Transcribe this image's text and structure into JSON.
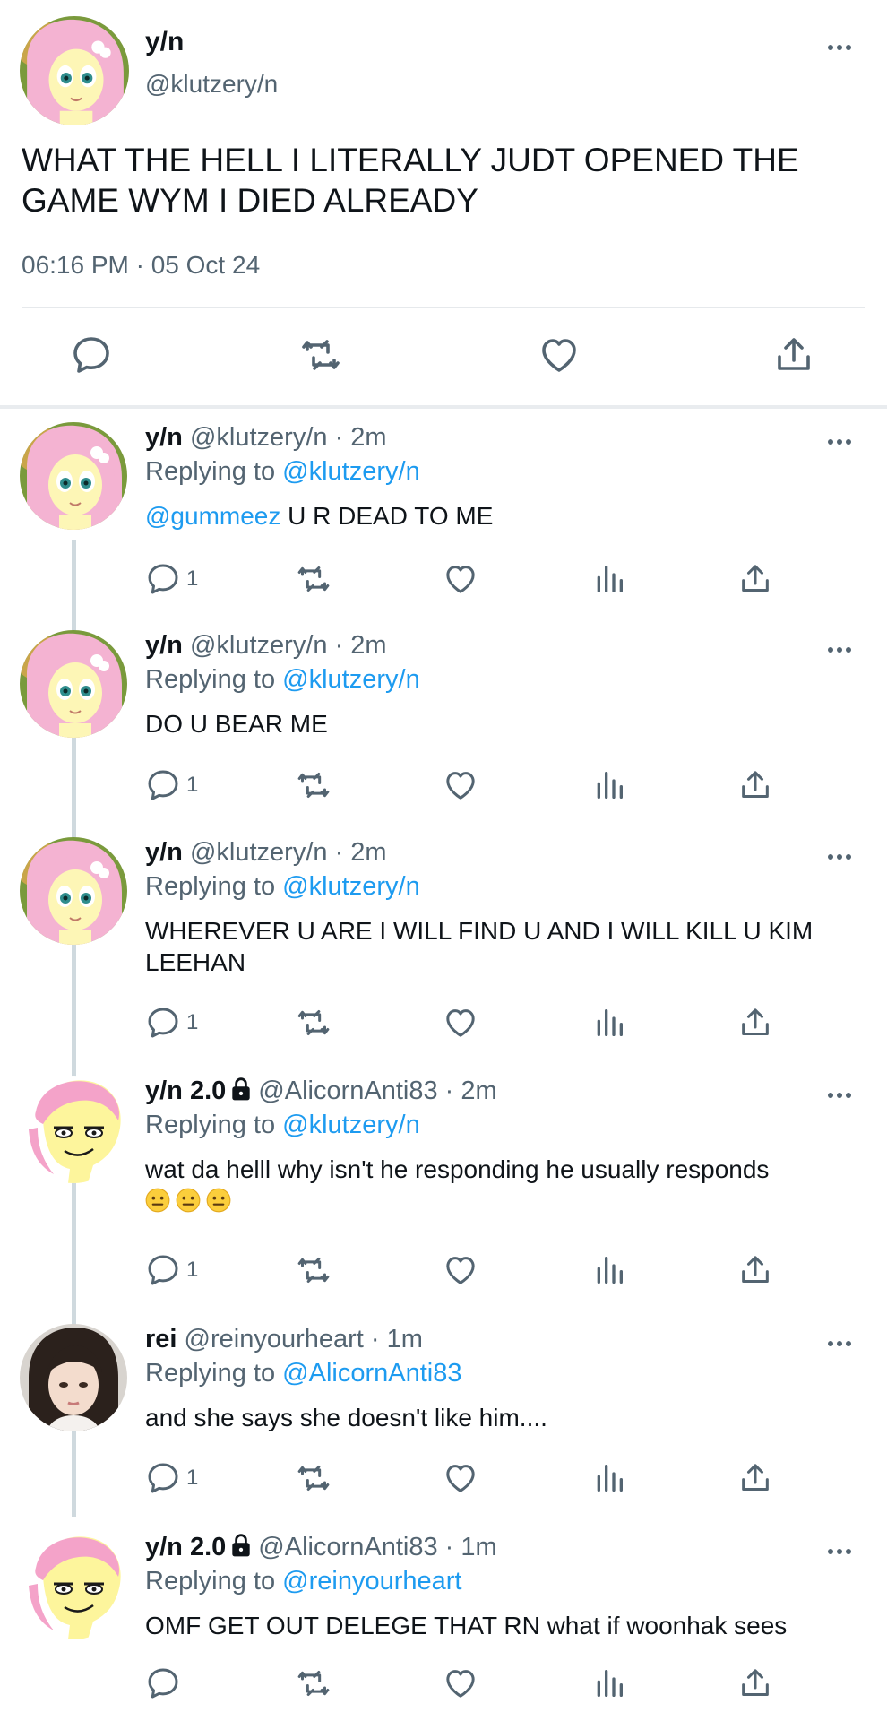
{
  "main_tweet": {
    "name": "y/n",
    "handle": "@klutzery/n",
    "text": "WHAT THE HELL I LITERALLY JUDT OPENED THE GAME WYM I DIED ALREADY",
    "timestamp": "06:16 PM · 05 Oct 24"
  },
  "replies": [
    {
      "name": "y/n",
      "handle": "@klutzery/n",
      "time": "2m",
      "replying_prefix": "Replying to ",
      "replying_to": "@klutzery/n",
      "mention": "@gummeez",
      "text": " U R DEAD TO ME",
      "reply_count": "1"
    },
    {
      "name": "y/n",
      "handle": "@klutzery/n",
      "time": "2m",
      "replying_prefix": "Replying to ",
      "replying_to": "@klutzery/n",
      "text": "DO U BEAR ME",
      "reply_count": "1"
    },
    {
      "name": "y/n",
      "handle": "@klutzery/n",
      "time": "2m",
      "replying_prefix": "Replying to ",
      "replying_to": "@klutzery/n",
      "text": "WHEREVER U ARE I WILL FIND U AND I WILL KILL U KIM LEEHAN",
      "reply_count": "1"
    },
    {
      "name": "y/n 2.0",
      "handle": "@AlicornAnti83",
      "time": "2m",
      "replying_prefix": "Replying to ",
      "replying_to": "@klutzery/n",
      "text": "wat da helll why isn't he responding he usually responds",
      "reply_count": "1"
    },
    {
      "name": "rei",
      "handle": "@reinyourheart",
      "time": "1m",
      "replying_prefix": "Replying to ",
      "replying_to": "@AlicornAnti83",
      "text": "and she says she doesn't like him....",
      "reply_count": "1"
    },
    {
      "name": "y/n 2.0",
      "handle": "@AlicornAnti83",
      "time": "1m",
      "replying_prefix": "Replying to ",
      "replying_to": "@reinyourheart",
      "text": "OMF GET OUT DELEGE THAT RN what if woonhak sees",
      "reply_count": ""
    }
  ],
  "sep": " · ",
  "icons": [
    "more-icon",
    "reply-icon",
    "retweet-icon",
    "like-icon",
    "views-icon",
    "share-icon",
    "lock-icon",
    "neutral-face-emoji"
  ],
  "colors": {
    "link": "#1d9bf0",
    "secondary_text": "#536471",
    "icon": "#536471",
    "thread_line": "#cfd9de"
  }
}
